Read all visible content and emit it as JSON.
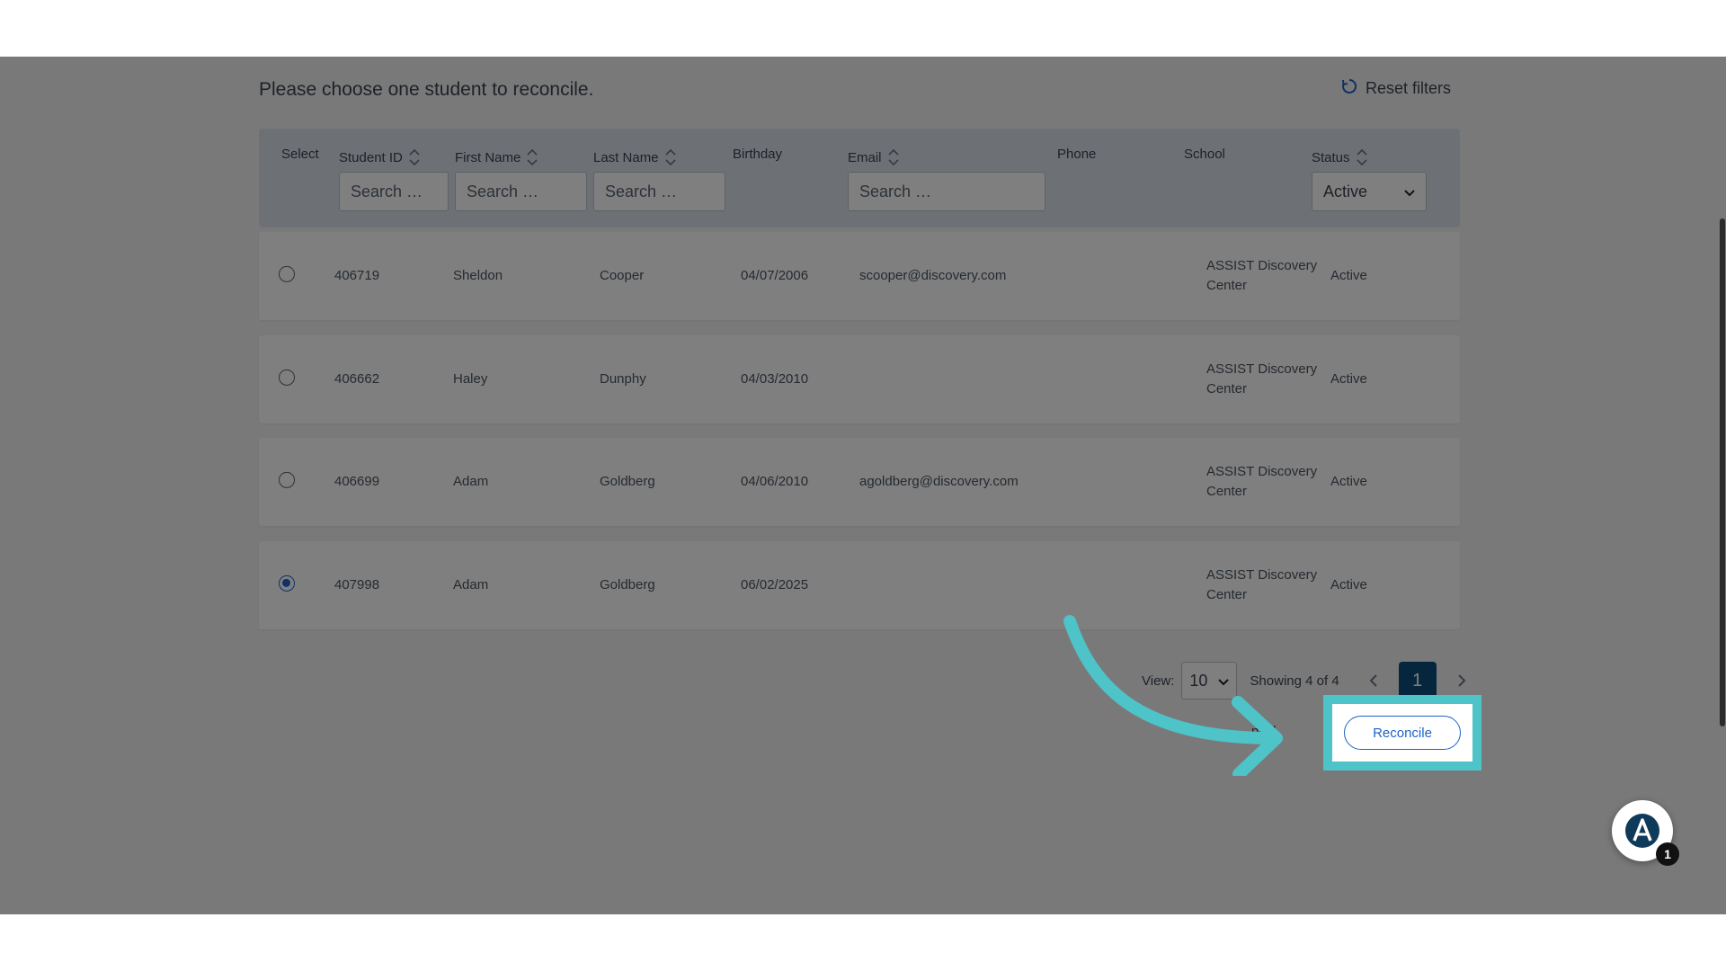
{
  "page": {
    "instruction": "Please choose one student to reconcile.",
    "reset_filters_label": "Reset filters"
  },
  "columns": {
    "select": "Select",
    "student_id": "Student ID",
    "first_name": "First Name",
    "last_name": "Last Name",
    "birthday": "Birthday",
    "email": "Email",
    "phone": "Phone",
    "school": "School",
    "status": "Status"
  },
  "filters": {
    "student_id_placeholder": "Search …",
    "first_name_placeholder": "Search …",
    "last_name_placeholder": "Search …",
    "email_placeholder": "Search …",
    "status_value": "Active"
  },
  "rows": [
    {
      "id": "406719",
      "first": "Sheldon",
      "last": "Cooper",
      "birthday": "04/07/2006",
      "email": "scooper@discovery.com",
      "phone": "",
      "school_line1": "ASSIST Discovery",
      "school_line2": "Center",
      "status": "Active",
      "selected": false
    },
    {
      "id": "406662",
      "first": "Haley",
      "last": "Dunphy",
      "birthday": "04/03/2010",
      "email": "",
      "phone": "",
      "school_line1": "ASSIST Discovery",
      "school_line2": "Center",
      "status": "Active",
      "selected": false
    },
    {
      "id": "406699",
      "first": "Adam",
      "last": "Goldberg",
      "birthday": "04/06/2010",
      "email": "agoldberg@discovery.com",
      "phone": "",
      "school_line1": "ASSIST Discovery",
      "school_line2": "Center",
      "status": "Active",
      "selected": false
    },
    {
      "id": "407998",
      "first": "Adam",
      "last": "Goldberg",
      "birthday": "06/02/2025",
      "email": "",
      "phone": "",
      "school_line1": "ASSIST Discovery",
      "school_line2": "Center",
      "status": "Active",
      "selected": true
    }
  ],
  "pager": {
    "view_label": "View:",
    "view_value": "10",
    "showing": "Showing 4 of 4",
    "current_page": "1"
  },
  "actions": {
    "cancel_label_visible": "ncel",
    "reconcile_label": "Reconcile"
  },
  "fab": {
    "badge": "1"
  },
  "colors": {
    "accent": "#1e63c9",
    "highlight": "#4ec3c8",
    "page_button": "#0d4d7a"
  }
}
